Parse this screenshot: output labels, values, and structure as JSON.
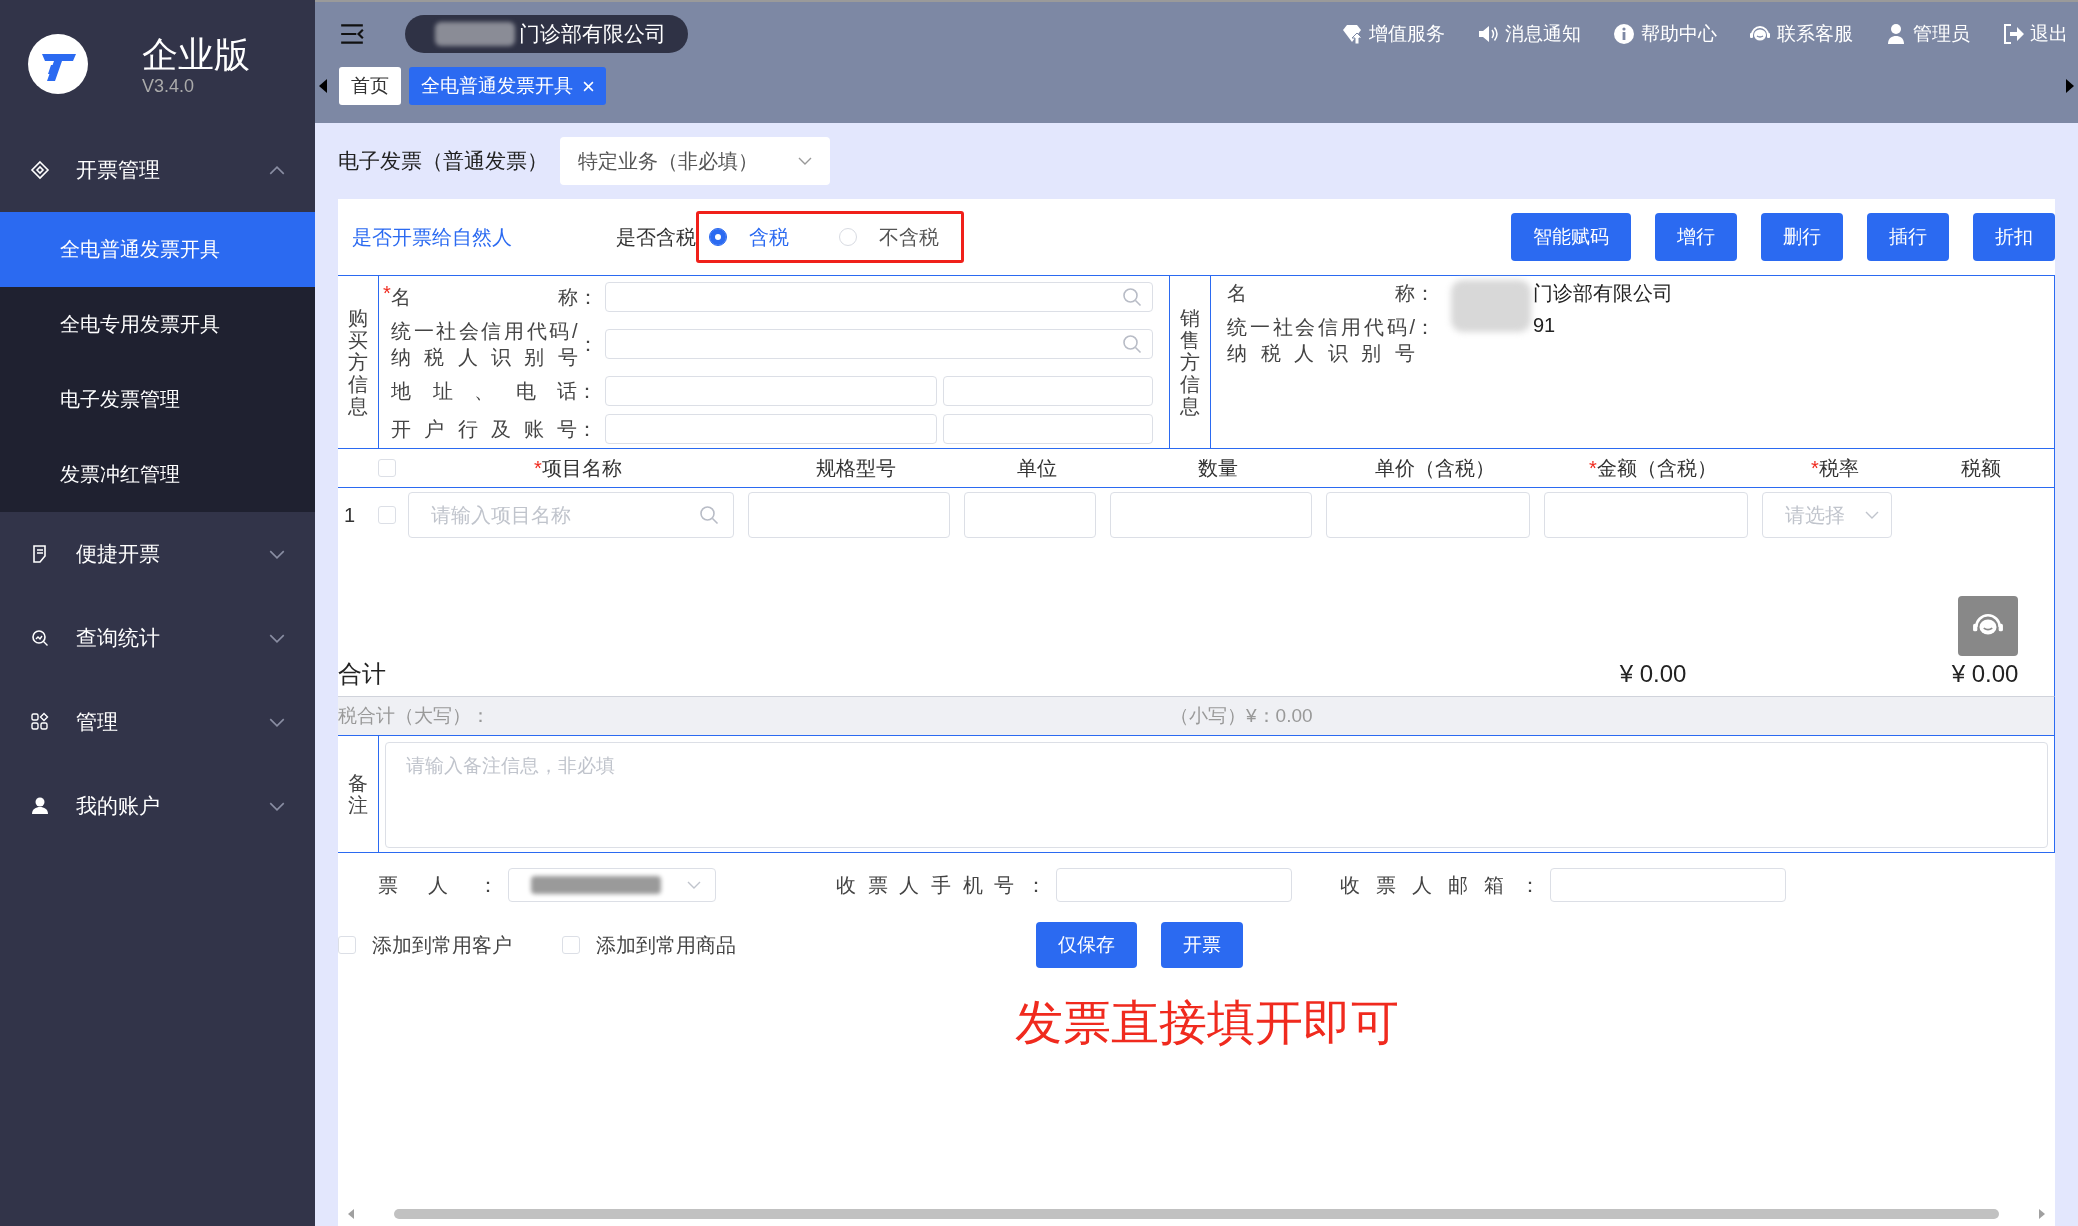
{
  "app": {
    "edition": "企业版",
    "version": "V3.4.0"
  },
  "sidebar": {
    "items": [
      {
        "label": "开票管理",
        "kind": "ticket",
        "expanded": true,
        "children": [
          {
            "label": "全电普通发票开具",
            "selected": true
          },
          {
            "label": "全电专用发票开具",
            "selected": false
          },
          {
            "label": "电子发票管理",
            "selected": false
          },
          {
            "label": "发票冲红管理",
            "selected": false
          }
        ]
      },
      {
        "label": "便捷开票",
        "kind": "doc",
        "expanded": false
      },
      {
        "label": "查询统计",
        "kind": "search",
        "expanded": false
      },
      {
        "label": "管理",
        "kind": "grid",
        "expanded": false
      },
      {
        "label": "我的账户",
        "kind": "user",
        "expanded": false
      }
    ]
  },
  "header": {
    "company": "门诊部有限公司",
    "actions": [
      {
        "label": "增值服务",
        "kind": "gem"
      },
      {
        "label": "消息通知",
        "kind": "speaker"
      },
      {
        "label": "帮助中心",
        "kind": "info"
      },
      {
        "label": "联系客服",
        "kind": "headset"
      },
      {
        "label": "管理员",
        "kind": "user"
      },
      {
        "label": "退出",
        "kind": "logout"
      }
    ]
  },
  "tabs": [
    {
      "label": "首页",
      "selected": false,
      "closable": false
    },
    {
      "label": "全电普通发票开具",
      "selected": true,
      "closable": true
    }
  ],
  "invoice": {
    "type_label": "电子发票（普通发票）",
    "special_business": {
      "value": "特定业务（非必填）"
    },
    "natural_person_link": "是否开票给自然人",
    "tax_included": {
      "label": "是否含税",
      "options": [
        {
          "label": "含税",
          "selected": true
        },
        {
          "label": "不含税",
          "selected": false
        }
      ]
    },
    "toolbar": [
      "智能赋码",
      "增行",
      "删行",
      "插行",
      "折扣"
    ],
    "buyer": {
      "title": "购买方信息",
      "fields": [
        {
          "label_lines": [
            "名称"
          ],
          "required_mark": "*",
          "colon": "：",
          "kind": "search"
        },
        {
          "label_lines": [
            "统一社会信用代码/",
            "纳税人识别号"
          ],
          "colon": "：",
          "kind": "search"
        },
        {
          "label_lines": [
            "地址、电话"
          ],
          "colon": "：",
          "kind": "pair"
        },
        {
          "label_lines": [
            "开户行及账号"
          ],
          "colon": "：",
          "kind": "pair"
        }
      ]
    },
    "seller": {
      "title": "销售方信息",
      "fields": [
        {
          "label_lines": [
            "名称"
          ],
          "colon": "：",
          "value": "门诊部有限公司"
        },
        {
          "label_lines": [
            "统一社会信用代码/",
            "纳税人识别号"
          ],
          "colon": "：",
          "value": "91"
        }
      ]
    },
    "items": {
      "columns": [
        {
          "label": "项目名称",
          "required_mark": "*"
        },
        {
          "label": "规格型号"
        },
        {
          "label": "单位"
        },
        {
          "label": "数量"
        },
        {
          "label": "单价（含税）"
        },
        {
          "label": "金额（含税）",
          "required_mark": "*"
        },
        {
          "label": "税率",
          "required_mark": "*"
        },
        {
          "label": "税额"
        }
      ],
      "all_checked": false,
      "rows": [
        {
          "index": "1",
          "checked": false,
          "name_placeholder": "请输入项目名称",
          "tax_rate_placeholder": "请选择"
        }
      ]
    },
    "totals": {
      "label": "合计",
      "amount": "¥ 0.00",
      "tax": "¥ 0.00"
    },
    "grand_total": {
      "upper_label": "税合计（大写）：",
      "lower": "（小写）¥：0.00"
    },
    "notes": {
      "label": "备注",
      "placeholder": "请输入备注信息，非必填"
    },
    "recipients": [
      {
        "label": "票人：",
        "kind": "select"
      },
      {
        "label": "收票人手机号：",
        "kind": "input"
      },
      {
        "label": "收票人邮箱：",
        "kind": "input"
      }
    ],
    "options": [
      {
        "label": "添加到常用客户",
        "checked": false
      },
      {
        "label": "添加到常用商品",
        "checked": false
      }
    ],
    "actions": [
      "仅保存",
      "开票"
    ]
  },
  "annotation": "发票直接填开即可"
}
